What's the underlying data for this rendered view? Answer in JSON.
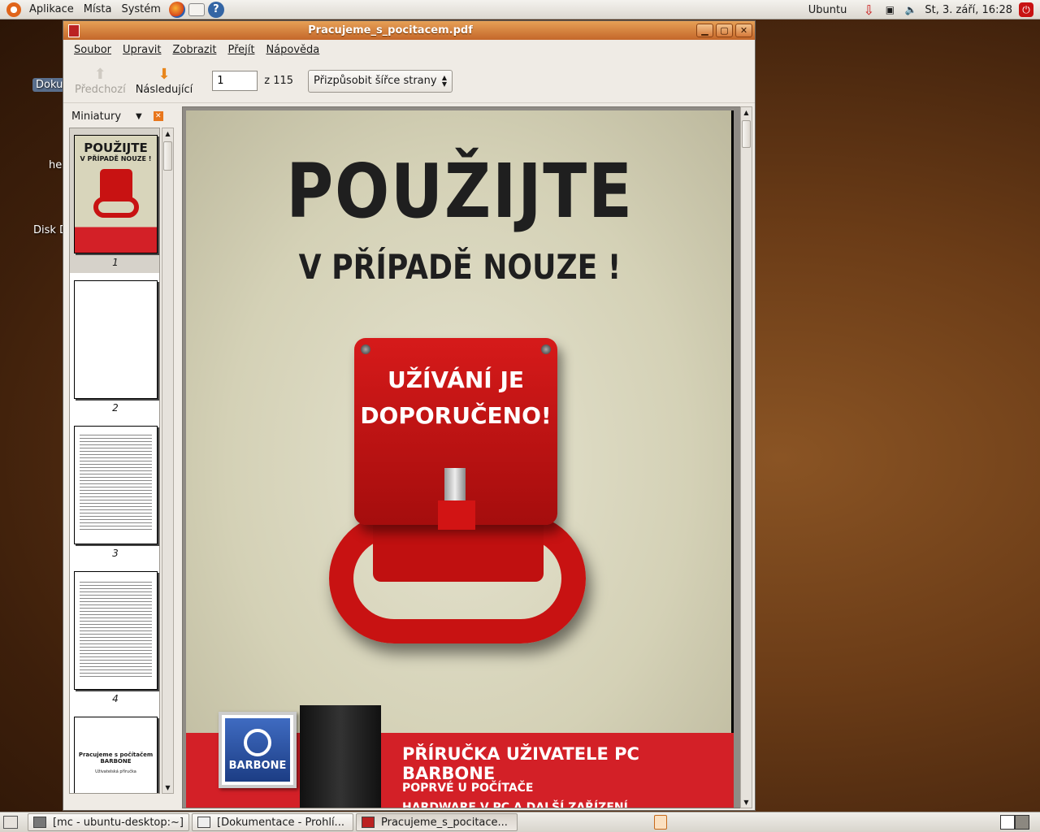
{
  "top_panel": {
    "menus": [
      "Aplikace",
      "Místa",
      "Systém"
    ],
    "user": "Ubuntu",
    "clock": "St,  3. září, 16:28"
  },
  "desktop": {
    "icons": [
      "Doku",
      "he",
      "Disk D"
    ]
  },
  "window": {
    "title": "Pracujeme_s_pocitacem.pdf",
    "menus": [
      "Soubor",
      "Upravit",
      "Zobrazit",
      "Přejít",
      "Nápověda"
    ],
    "toolbar": {
      "prev_label": "Předchozí",
      "next_label": "Následující",
      "page_value": "1",
      "page_of": "z 115",
      "zoom_value": "Přizpůsobit šířce strany"
    },
    "sidebar": {
      "title": "Miniatury",
      "thumb_numbers": [
        "1",
        "2",
        "3",
        "4"
      ],
      "thumb1_title": "POUŽIJTE",
      "thumb1_sub": "V PŘÍPADĚ NOUZE !",
      "thumb5_title": "Pracujeme s počítačem",
      "thumb5_sub": "BARBONE",
      "thumb5_small": "Uživatelská příručka"
    },
    "page": {
      "headline": "POUŽIJTE",
      "subheadline": "V PŘÍPADĚ NOUZE !",
      "lever_line1": "UŽÍVÁNÍ JE",
      "lever_line2": "DOPORUČENO!",
      "banner_title": "PŘÍRUČKA UŽIVATELE PC BARBONE",
      "banner_line1": "POPRVÉ U POČÍTAČE",
      "banner_line2": "HARDWARE V PC A DALŠÍ ZAŘÍZENÍ",
      "brand": "BARBONE"
    }
  },
  "taskbar": {
    "tasks": [
      "[mc - ubuntu-desktop:~]",
      "[Dokumentace - Prohlí...",
      "Pracujeme_s_pocitace..."
    ]
  },
  "colors": {
    "title_orange": "#d67a3a",
    "banner_red": "#d32027",
    "lever_red": "#c81212"
  }
}
